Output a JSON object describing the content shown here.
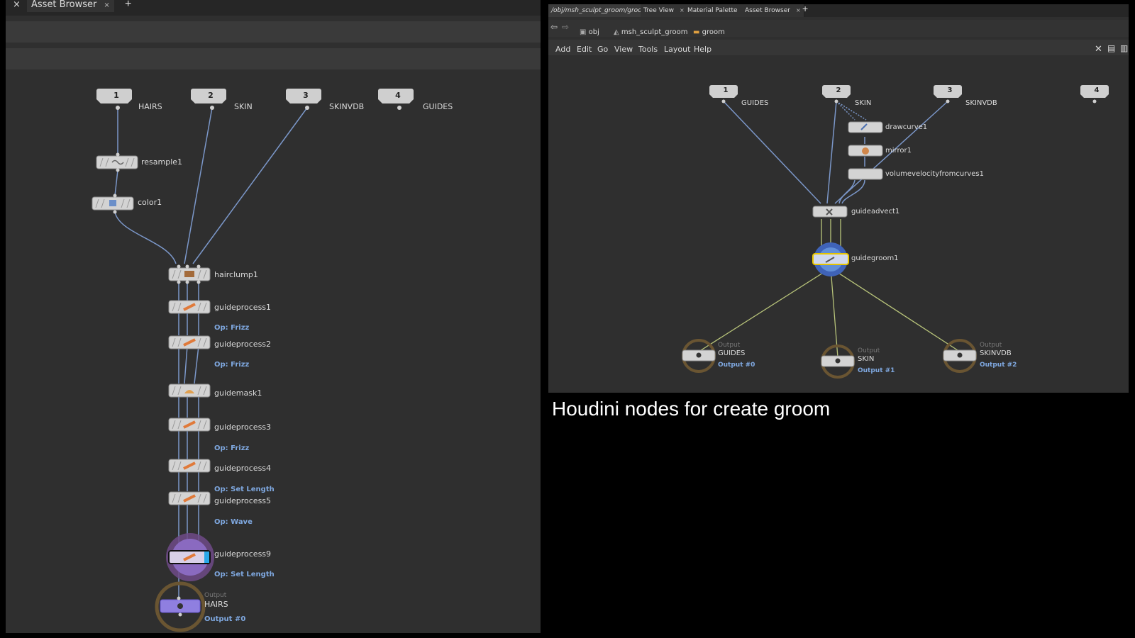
{
  "left": {
    "tabs": [
      {
        "label": "Asset Browser"
      }
    ],
    "inputs": [
      {
        "num": "1",
        "label": "HAIRS"
      },
      {
        "num": "2",
        "label": "SKIN"
      },
      {
        "num": "3",
        "label": "SKINVDB"
      },
      {
        "num": "4",
        "label": "GUIDES"
      }
    ],
    "nodes": [
      {
        "label": "resample1"
      },
      {
        "label": "color1"
      },
      {
        "label": "hairclump1"
      },
      {
        "label": "guideprocess1",
        "op": "Op: Frizz"
      },
      {
        "label": "guideprocess2",
        "op": "Op: Frizz"
      },
      {
        "label": "guidemask1"
      },
      {
        "label": "guideprocess3",
        "op": "Op: Frizz"
      },
      {
        "label": "guideprocess4",
        "op": "Op: Set Length"
      },
      {
        "label": "guideprocess5",
        "op": "Op: Wave"
      },
      {
        "label": "guideprocess9",
        "op": "Op: Set Length"
      }
    ],
    "output": {
      "caption": "Output",
      "label": "HAIRS",
      "sub": "Output #0"
    }
  },
  "right": {
    "tabs": [
      {
        "label": "/obj/msh_sculpt_groom/groom"
      },
      {
        "label": "Tree View"
      },
      {
        "label": "Material Palette"
      },
      {
        "label": "Asset Browser"
      }
    ],
    "breadcrumb": [
      "obj",
      "msh_sculpt_groom",
      "groom"
    ],
    "menu": [
      "Add",
      "Edit",
      "Go",
      "View",
      "Tools",
      "Layout",
      "Help"
    ],
    "inputs": [
      {
        "num": "1",
        "label": "GUIDES"
      },
      {
        "num": "2",
        "label": "SKIN"
      },
      {
        "num": "3",
        "label": "SKINVDB"
      },
      {
        "num": "4",
        "label": ""
      }
    ],
    "nodes": [
      {
        "label": "drawcurve1"
      },
      {
        "label": "mirror1"
      },
      {
        "label": "volumevelocityfromcurves1"
      },
      {
        "label": "guideadvect1"
      },
      {
        "label": "guidegroom1"
      }
    ],
    "outputs": [
      {
        "caption": "Output",
        "label": "GUIDES",
        "sub": "Output #0"
      },
      {
        "caption": "Output",
        "label": "SKIN",
        "sub": "Output #1"
      },
      {
        "caption": "Output",
        "label": "SKINVDB",
        "sub": "Output #2"
      }
    ]
  },
  "caption": "Houdini nodes for create groom",
  "colors": {
    "wire": "#7b97c9",
    "wire_yellow": "#b8c47a",
    "node": "#cfcfcf",
    "panel": "#2f2f2f"
  }
}
